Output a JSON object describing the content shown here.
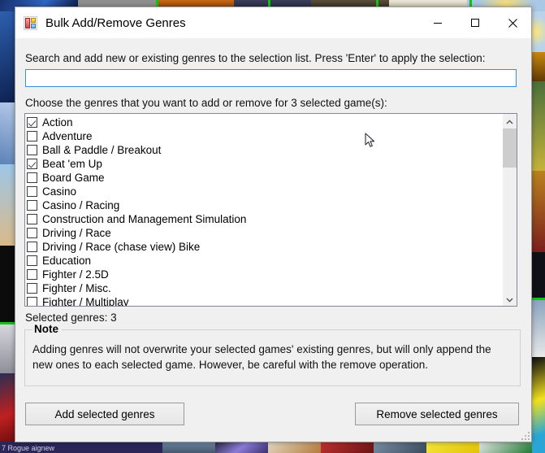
{
  "window": {
    "title": "Bulk Add/Remove Genres",
    "icon": "windows-form-icon",
    "controls": {
      "minimize": "minimize-icon",
      "maximize": "maximize-icon",
      "close": "close-icon"
    }
  },
  "search": {
    "label": "Search and add new or existing genres to the selection list. Press 'Enter' to apply the selection:",
    "value": "",
    "placeholder": ""
  },
  "genres": {
    "label": "Choose the genres that you want to add or remove for 3 selected game(s):",
    "items": [
      {
        "label": "Action",
        "checked": true
      },
      {
        "label": "Adventure",
        "checked": false
      },
      {
        "label": "Ball & Paddle / Breakout",
        "checked": false
      },
      {
        "label": "Beat 'em Up",
        "checked": true
      },
      {
        "label": "Board Game",
        "checked": false
      },
      {
        "label": "Casino",
        "checked": false
      },
      {
        "label": "Casino / Racing",
        "checked": false
      },
      {
        "label": "Construction and Management Simulation",
        "checked": false
      },
      {
        "label": "Driving / Race",
        "checked": false
      },
      {
        "label": "Driving / Race (chase view) Bike",
        "checked": false
      },
      {
        "label": "Education",
        "checked": false
      },
      {
        "label": "Fighter / 2.5D",
        "checked": false
      },
      {
        "label": "Fighter / Misc.",
        "checked": false
      },
      {
        "label": "Fighter / Multiplay",
        "checked": false
      }
    ],
    "scrollbar": {
      "up_arrow": "chevron-up-icon",
      "down_arrow": "chevron-down-icon"
    },
    "selected_count_text": "Selected genres: 3"
  },
  "note": {
    "title": "Note",
    "body": "Adding genres will not overwrite your selected games' existing genres, but will only append the new ones to each selected game. However, be careful with the remove operation."
  },
  "buttons": {
    "add": "Add selected genres",
    "remove": "Remove selected genres"
  },
  "background": {
    "caption": "7 Rogue aignew"
  },
  "colors": {
    "dialog_face": "#f0f0f0",
    "titlebar": "#ffffff",
    "input_border_focus": "#3c8fd4",
    "list_border": "#828790",
    "scroll_thumb": "#cdcdcd",
    "green_separator": "#13c513"
  }
}
